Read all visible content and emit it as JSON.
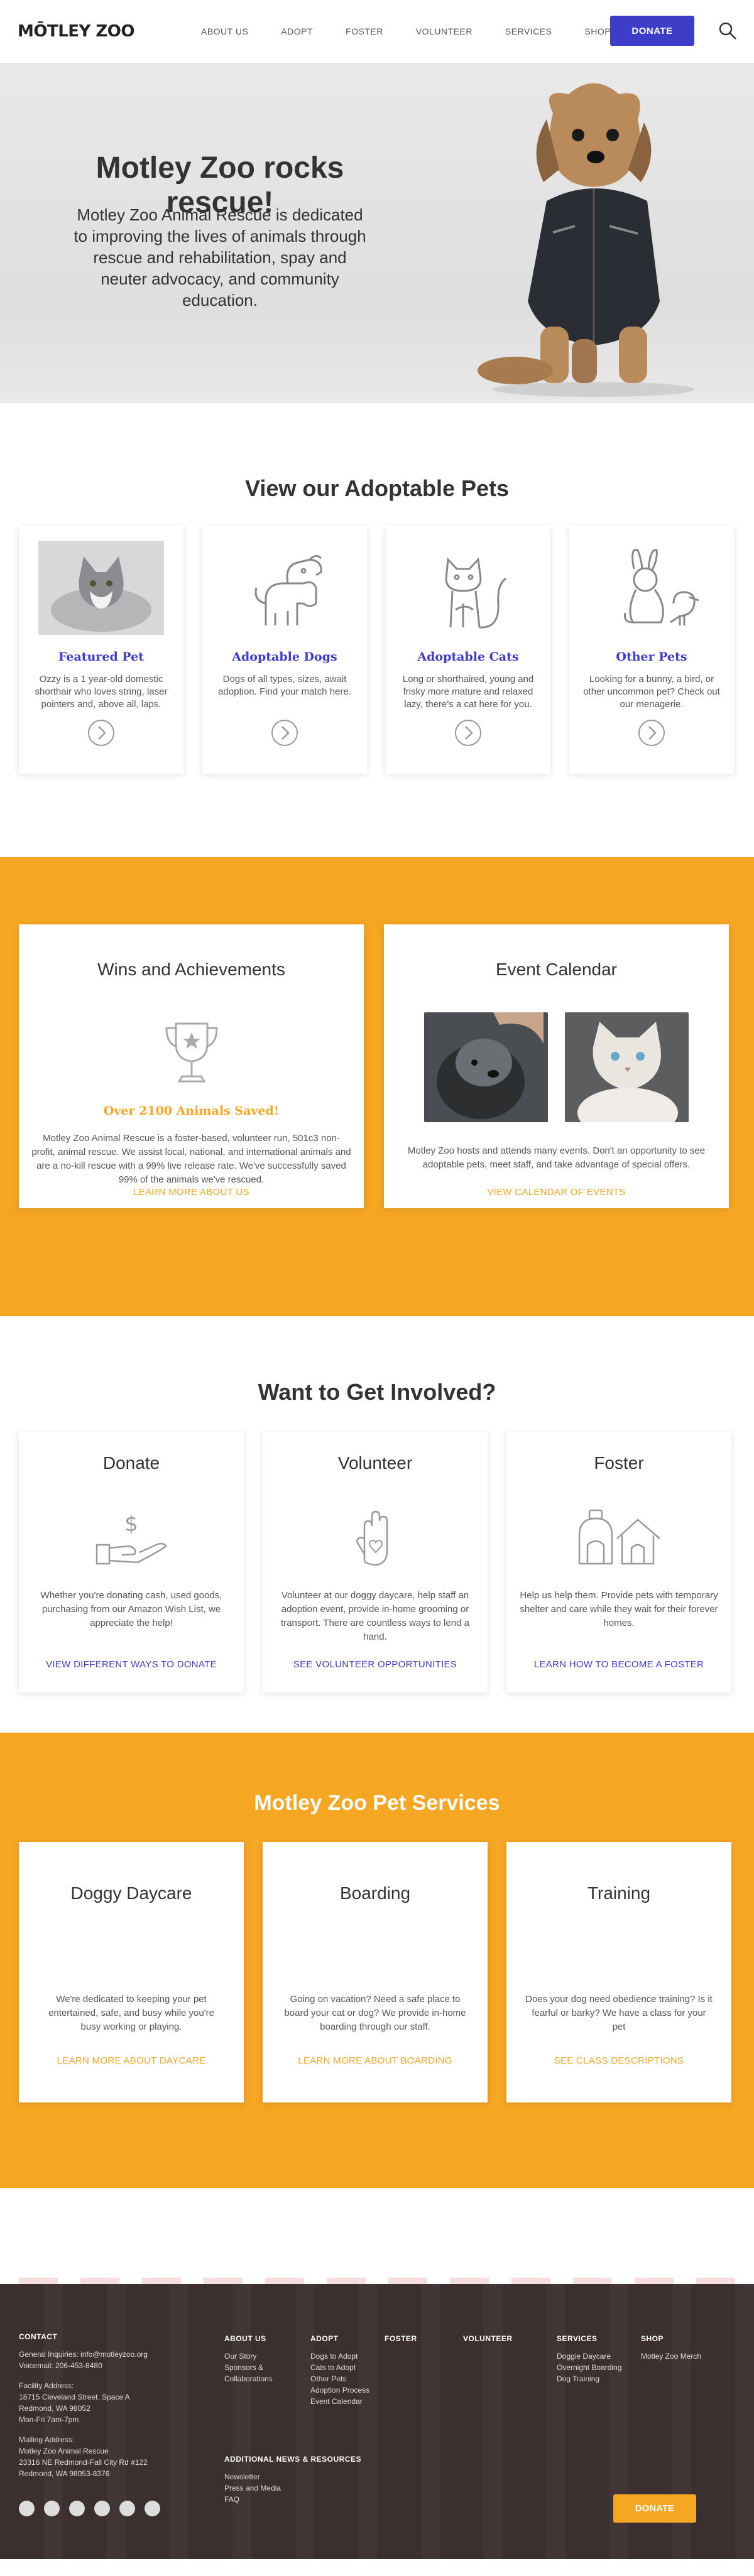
{
  "header": {
    "logo": "MŌTLEY ZOO",
    "nav": [
      "ABOUT US",
      "ADOPT",
      "FOSTER",
      "VOLUNTEER",
      "SERVICES",
      "SHOP"
    ],
    "donate": "DONATE"
  },
  "hero": {
    "title": "Motley Zoo rocks rescue!",
    "text": "Motley Zoo Animal Rescue is dedicated to improving the lives of animals through rescue and rehabilitation, spay and neuter advocacy, and community education."
  },
  "pets": {
    "title": "View our Adoptable Pets",
    "cards": [
      {
        "title": "Featured Pet",
        "text": "Ozzy is a 1 year-old domestic shorthair who loves string, laser pointers and, above all, laps.",
        "icon": "kitten-photo"
      },
      {
        "title": "Adoptable Dogs",
        "text": "Dogs of all types, sizes, await adoption. Find your match here.",
        "icon": "dog-icon"
      },
      {
        "title": "Adoptable Cats",
        "text": "Long or shorthaired, young and frisky more mature and relaxed lazy, there's a cat here for you.",
        "icon": "cat-icon"
      },
      {
        "title": "Other Pets",
        "text": "Looking for a bunny, a bird, or other uncommon pet? Check out our menagerie.",
        "icon": "bunny-bird-icon"
      }
    ]
  },
  "wins": {
    "title": "Wins and Achievements",
    "highlight": "Over 2100 Animals Saved!",
    "text": "Motley Zoo Animal Rescue is a foster-based, volunteer run, 501c3 non-profit, animal rescue. We assist local, national, and international animals and are a no-kill rescue with a 99% live release rate. We've successfully saved 99% of the animals we've rescued.",
    "link": "LEARN MORE ABOUT US"
  },
  "events": {
    "title": "Event Calendar",
    "text": "Motley Zoo hosts and attends many events. Don't an opportunity to see adoptable pets, meet staff, and take advantage of special offers.",
    "link": "VIEW CALENDAR OF EVENTS"
  },
  "involved": {
    "title": "Want to Get Involved?",
    "cards": [
      {
        "title": "Donate",
        "text": "Whether you're donating cash, used goods, purchasing from our Amazon Wish List, we appreciate the help!",
        "link": "VIEW DIFFERENT WAYS TO DONATE"
      },
      {
        "title": "Volunteer",
        "text": "Volunteer at our doggy daycare, help staff an adoption event, provide in-home grooming or transport. There are countless ways to lend a hand.",
        "link": "SEE VOLUNTEER OPPORTUNITIES"
      },
      {
        "title": "Foster",
        "text": "Help us help them. Provide pets with temporary shelter and care while they wait for their forever homes.",
        "link": "LEARN HOW TO BECOME A FOSTER"
      }
    ]
  },
  "services": {
    "title": "Motley Zoo Pet Services",
    "cards": [
      {
        "title": "Doggy Daycare",
        "text": "We're dedicated to keeping your pet entertained, safe, and busy while you're busy working or playing.",
        "link": "LEARN MORE ABOUT DAYCARE"
      },
      {
        "title": "Boarding",
        "text": "Going on vacation? Need a safe place to board your cat or dog? We provide in-home boarding through our staff.",
        "link": "LEARN MORE ABOUT BOARDING"
      },
      {
        "title": "Training",
        "text": "Does your dog need obedience training? Is it fearful or barky? We have a class for your pet",
        "link": "SEE CLASS DESCRIPTIONS"
      }
    ]
  },
  "footer": {
    "contact_title": "CONTACT",
    "contact_lines": [
      "General Inquiries: info@motleyzoo.org",
      "Voicemail: 206-453-8480"
    ],
    "facility_lines": [
      "Facility Address:",
      "18715 Cleveland Street, Space A",
      "Redmond, WA 98052",
      "Mon-Fri 7am-7pm"
    ],
    "mailing_lines": [
      "Mailing Address:",
      "Motley Zoo Animal Rescue",
      "23316 NE Redmond-Fall City Rd #122",
      "Redmond, WA 98053-8376"
    ],
    "about_title": "ABOUT US",
    "about_items": [
      "Our Story",
      "Sponsors &",
      "Collaborations"
    ],
    "adopt_title": "ADOPT",
    "adopt_items": [
      "Dogs to Adopt",
      "Cats to Adopt",
      "Other Pets",
      "Adoption Process",
      "Event Calendar"
    ],
    "foster_title": "FOSTER",
    "volunteer_title": "VOLUNTEER",
    "services_title": "SERVICES",
    "services_items": [
      "Doggie Daycare",
      "Overnight Boarding",
      "Dog Training"
    ],
    "shop_title": "SHOP",
    "shop_items": [
      "Motley Zoo Merch"
    ],
    "resources_title": "ADDITIONAL NEWS & RESOURCES",
    "resources_items": [
      "Newsletter",
      "Press and Media",
      "FAQ"
    ],
    "donate": "DONATE",
    "social_icons": [
      "facebook-icon",
      "twitter-icon",
      "email-icon",
      "pinterest-icon",
      "instagram-icon",
      "youtube-icon"
    ]
  },
  "colors": {
    "accent": "#f5a623",
    "brand": "#3d3dc7",
    "footer": "#3b2f2f"
  }
}
